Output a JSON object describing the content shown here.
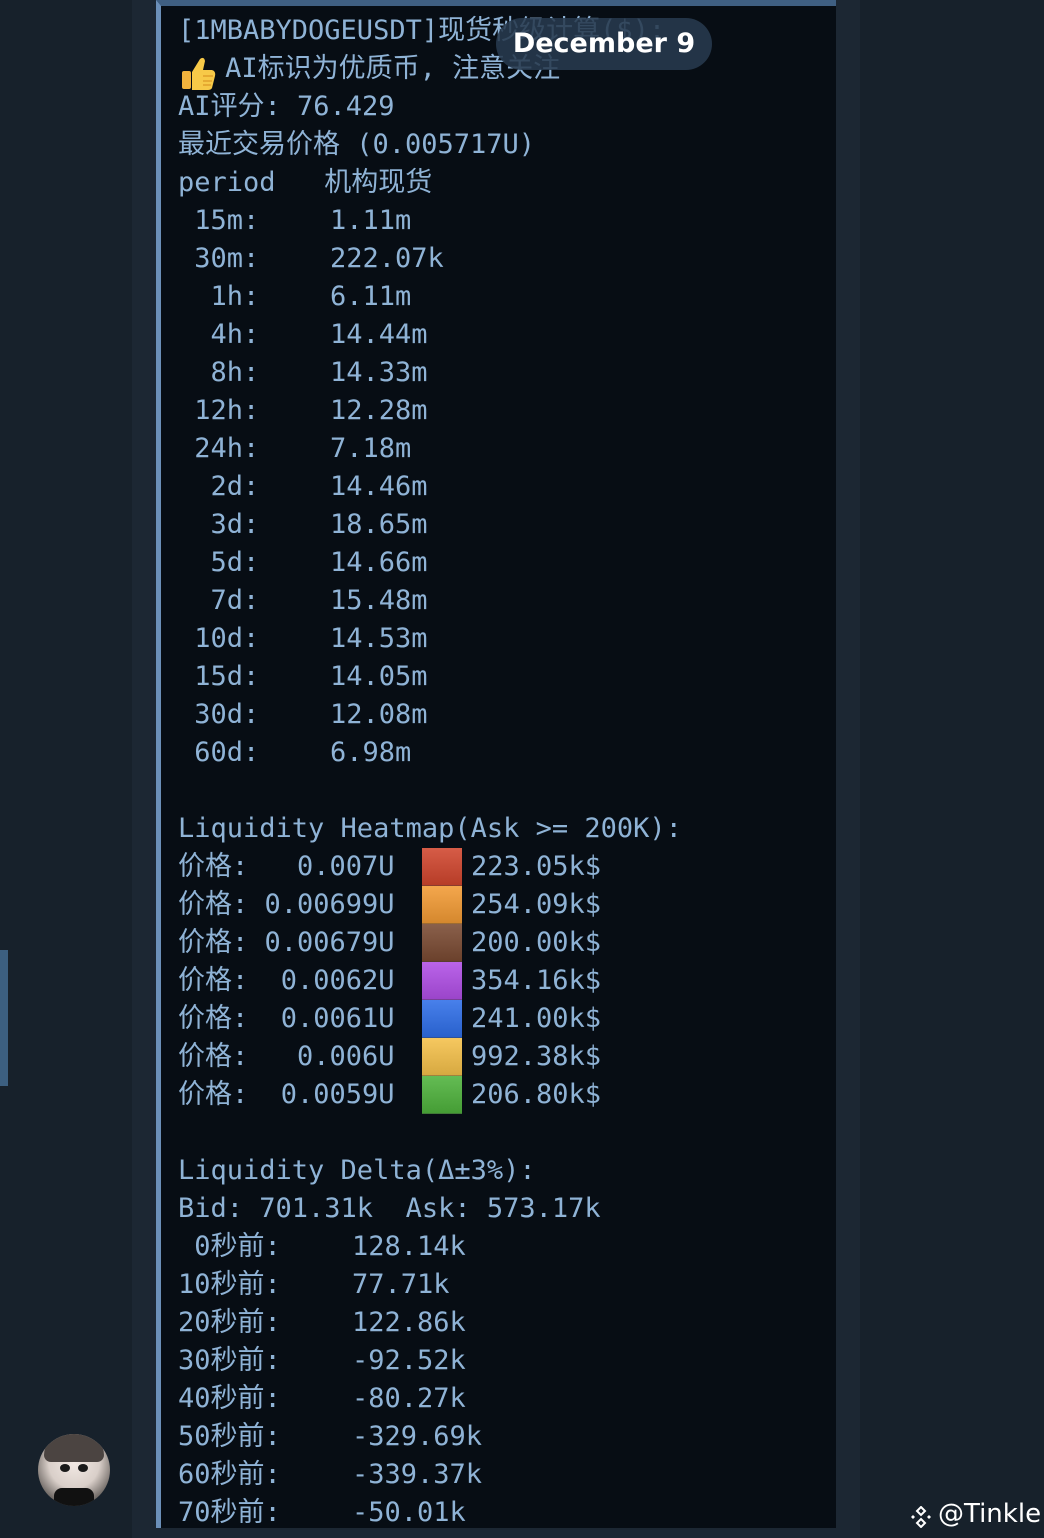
{
  "date_pill": "December 9",
  "message": {
    "header_line": "[1MBABYDOGEUSDT]现货秒级计算($):",
    "ai_note": "AI标识为优质币, 注意关注",
    "ai_score": "AI评分: 76.429",
    "last_price": "最近交易价格 (0.005717U)",
    "period_header": "period   机构现货",
    "periods": [
      {
        "label": " 15m:",
        "value": "1.11m"
      },
      {
        "label": " 30m:",
        "value": "222.07k"
      },
      {
        "label": "  1h:",
        "value": "6.11m"
      },
      {
        "label": "  4h:",
        "value": "14.44m"
      },
      {
        "label": "  8h:",
        "value": "14.33m"
      },
      {
        "label": " 12h:",
        "value": "12.28m"
      },
      {
        "label": " 24h:",
        "value": "7.18m"
      },
      {
        "label": "  2d:",
        "value": "14.46m"
      },
      {
        "label": "  3d:",
        "value": "18.65m"
      },
      {
        "label": "  5d:",
        "value": "14.66m"
      },
      {
        "label": "  7d:",
        "value": "15.48m"
      },
      {
        "label": " 10d:",
        "value": "14.53m"
      },
      {
        "label": " 15d:",
        "value": "14.05m"
      },
      {
        "label": " 30d:",
        "value": "12.08m"
      },
      {
        "label": " 60d:",
        "value": "6.98m"
      }
    ],
    "heatmap_title": "Liquidity Heatmap(Ask >= 200K):",
    "heatmap_rows": [
      {
        "price": "价格:   0.007U",
        "amount": "223.05k$",
        "color": "#d0452d"
      },
      {
        "price": "价格: 0.00699U",
        "amount": "254.09k$",
        "color": "#f29b34"
      },
      {
        "price": "价格: 0.00679U",
        "amount": "200.00k$",
        "color": "#7a4a32"
      },
      {
        "price": "价格:  0.0062U",
        "amount": "354.16k$",
        "color": "#b04fe6"
      },
      {
        "price": "价格:  0.0061U",
        "amount": "241.00k$",
        "color": "#2f6ee8"
      },
      {
        "price": "价格:   0.006U",
        "amount": "992.38k$",
        "color": "#f5c04a"
      },
      {
        "price": "价格:  0.0059U",
        "amount": "206.80k$",
        "color": "#4fb33c"
      }
    ],
    "delta_title": "Liquidity Delta(Δ±3%):",
    "delta_summary": "Bid: 701.31k  Ask: 573.17k",
    "delta_rows": [
      {
        "label": " 0秒前:",
        "value": "128.14k"
      },
      {
        "label": "10秒前:",
        "value": "77.71k"
      },
      {
        "label": "20秒前:",
        "value": "122.86k"
      },
      {
        "label": "30秒前:",
        "value": "-92.52k"
      },
      {
        "label": "40秒前:",
        "value": "-80.27k"
      },
      {
        "label": "50秒前:",
        "value": "-329.69k"
      },
      {
        "label": "60秒前:",
        "value": "-339.37k"
      },
      {
        "label": "70秒前:",
        "value": "-50.01k"
      }
    ]
  },
  "watermark": "@Tinkle",
  "icons": {
    "thumb": "thumbs-up-icon",
    "logo": "binance-logo-icon"
  }
}
